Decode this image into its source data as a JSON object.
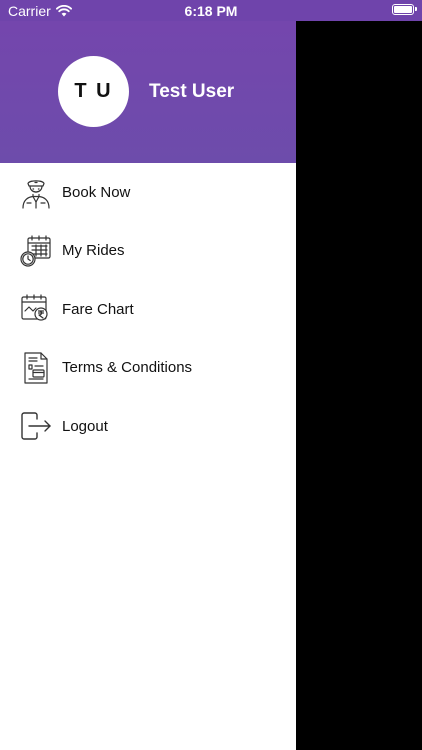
{
  "status_bar": {
    "carrier": "Carrier",
    "time": "6:18 PM"
  },
  "drawer": {
    "avatar_initials": "T U",
    "user_name": "Test User",
    "menu": [
      {
        "label": "Book Now",
        "icon": "driver-icon"
      },
      {
        "label": "My Rides",
        "icon": "calendar-clock-icon"
      },
      {
        "label": "Fare Chart",
        "icon": "calendar-rupee-icon"
      },
      {
        "label": "Terms & Conditions",
        "icon": "document-icon"
      },
      {
        "label": "Logout",
        "icon": "logout-icon"
      }
    ]
  },
  "colors": {
    "header_purple": "#7446ad",
    "menu_text": "#111111",
    "overlay": "#000000"
  }
}
